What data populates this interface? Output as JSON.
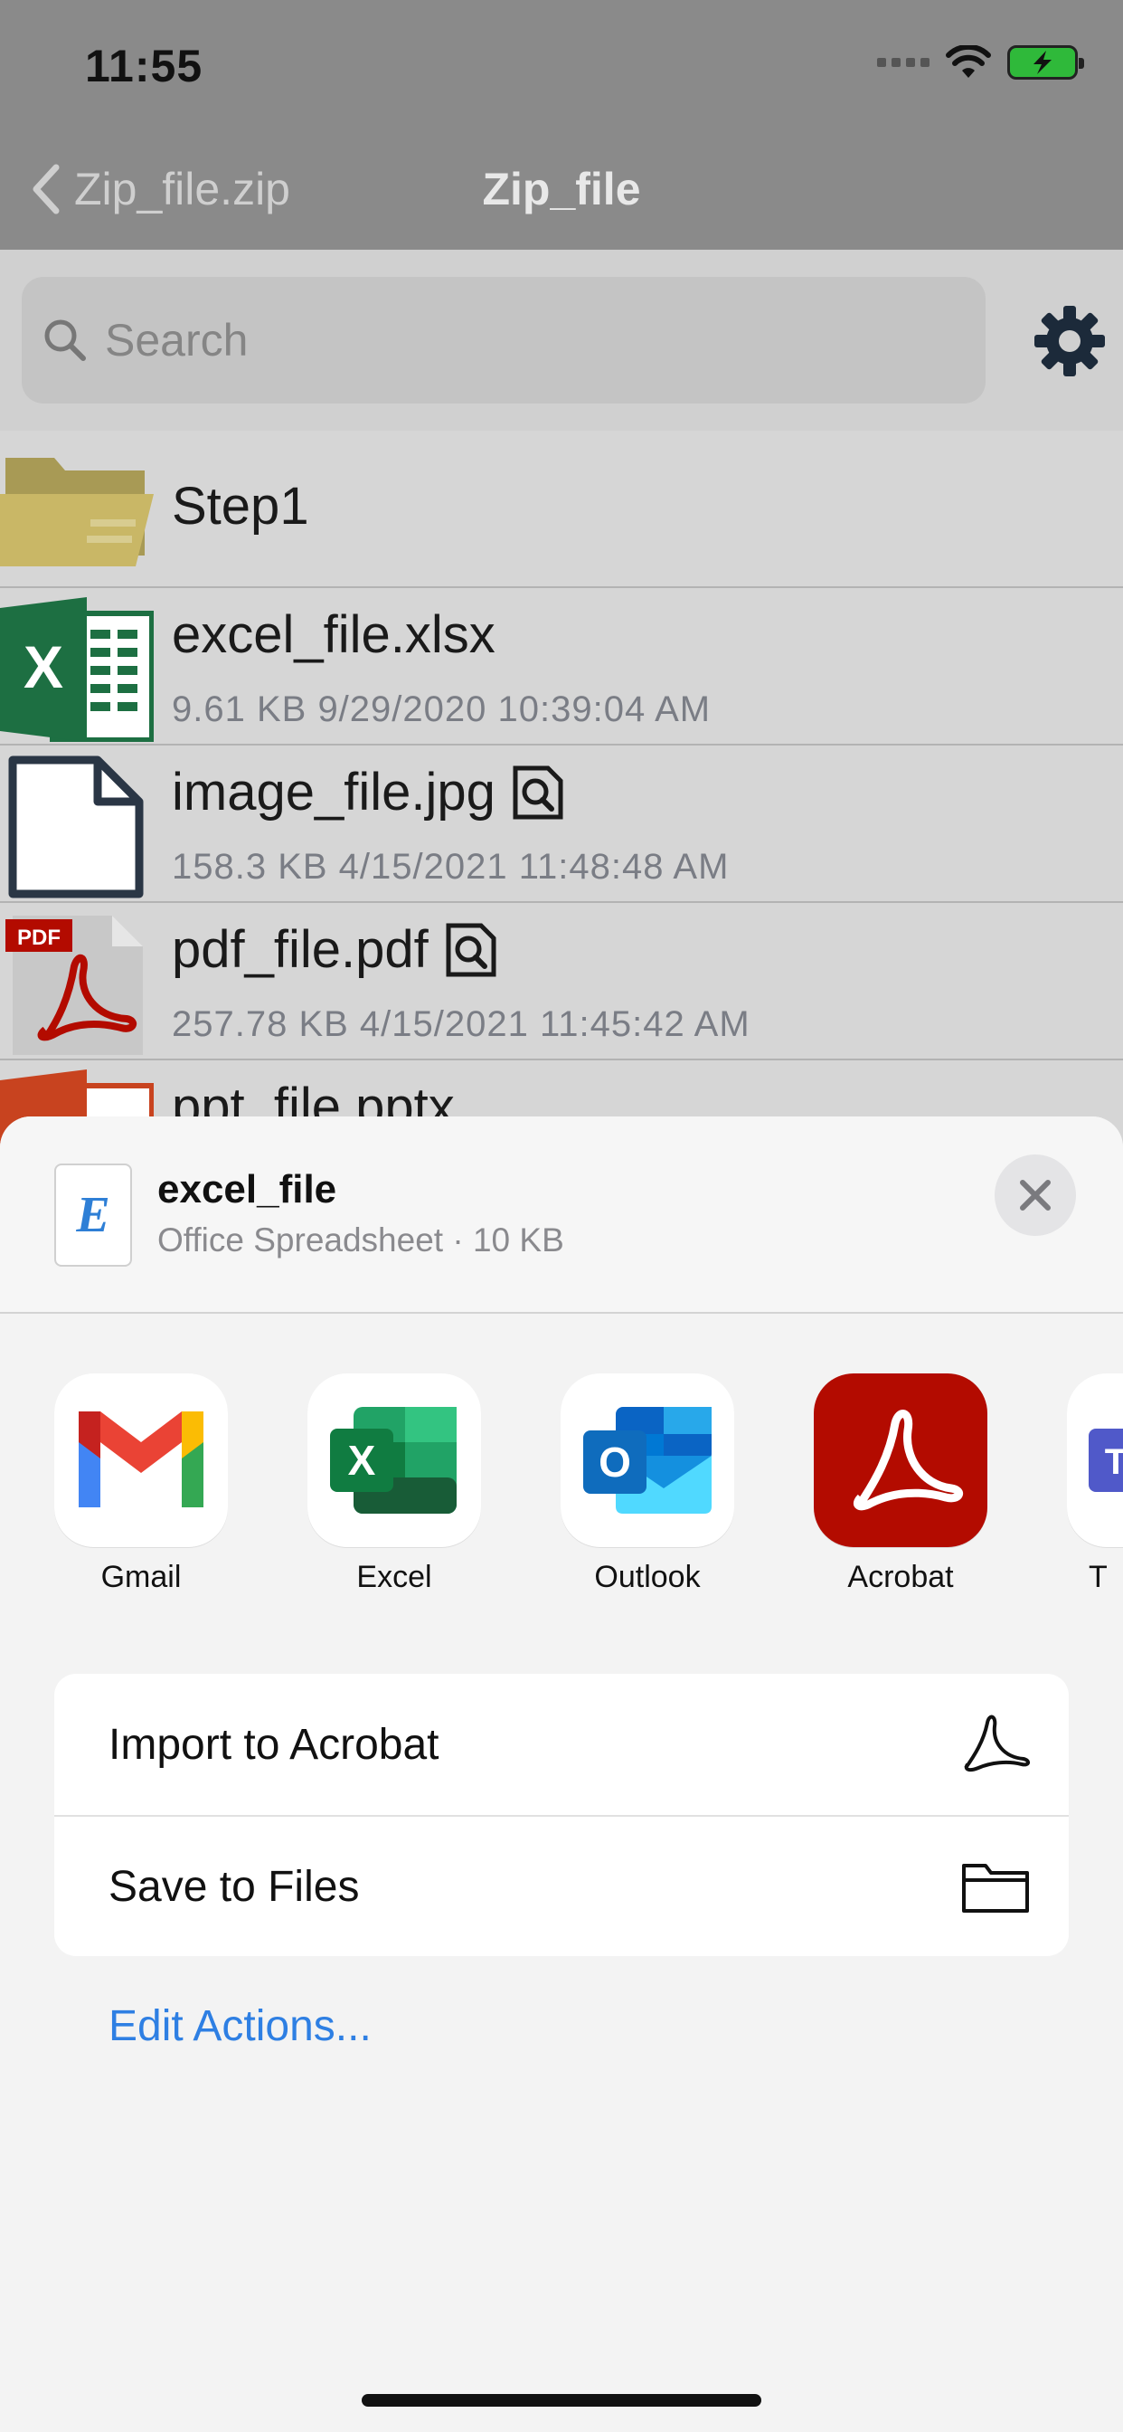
{
  "status": {
    "time": "11:55"
  },
  "nav": {
    "back_label": "Zip_file.zip",
    "title": "Zip_file"
  },
  "search": {
    "placeholder": "Search"
  },
  "files": [
    {
      "name": "Step1",
      "meta": "",
      "icon": "folder-icon"
    },
    {
      "name": "excel_file.xlsx",
      "meta": "9.61 KB  9/29/2020 10:39:04 AM",
      "icon": "excel-file-icon"
    },
    {
      "name": "image_file.jpg",
      "meta": "158.3 KB  4/15/2021 11:48:48 AM",
      "icon": "generic-file-icon"
    },
    {
      "name": "pdf_file.pdf",
      "meta": "257.78 KB  4/15/2021 11:45:42 AM",
      "icon": "pdf-file-icon",
      "badge": "PDF"
    },
    {
      "name": "ppt_file.pptx",
      "meta": "",
      "icon": "ppt-file-icon"
    }
  ],
  "share": {
    "file_title": "excel_file",
    "file_subtitle": "Office Spreadsheet · 10 KB",
    "apps": [
      {
        "label": "Gmail",
        "icon": "gmail-icon"
      },
      {
        "label": "Excel",
        "icon": "excel-icon"
      },
      {
        "label": "Outlook",
        "icon": "outlook-icon"
      },
      {
        "label": "Acrobat",
        "icon": "acrobat-icon"
      },
      {
        "label": "T",
        "icon": "teams-icon"
      }
    ],
    "actions": [
      {
        "label": "Import to Acrobat",
        "icon": "acrobat-icon"
      },
      {
        "label": "Save to Files",
        "icon": "folder-icon"
      }
    ],
    "edit_label": "Edit Actions..."
  },
  "colors": {
    "accent": "#2e7fe3",
    "acrobat_red": "#b30b00",
    "excel_green": "#1d6f42"
  }
}
